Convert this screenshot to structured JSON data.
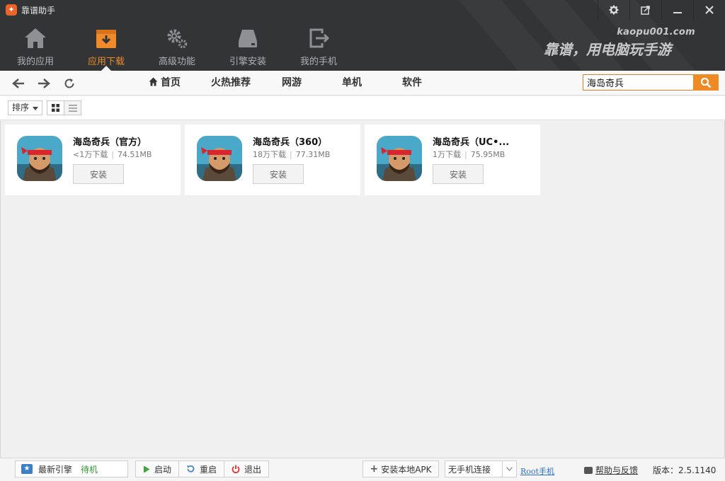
{
  "window": {
    "title": "靠谱助手"
  },
  "nav_tabs": [
    {
      "label": "我的应用",
      "icon": "home-icon",
      "active": false
    },
    {
      "label": "应用下载",
      "icon": "download-box-icon",
      "active": true
    },
    {
      "label": "高级功能",
      "icon": "gears-icon",
      "active": false
    },
    {
      "label": "引擎安装",
      "icon": "drive-icon",
      "active": false
    },
    {
      "label": "我的手机",
      "icon": "phone-exit-icon",
      "active": false
    }
  ],
  "brand": {
    "url": "kaopu001.com",
    "slogan": "靠谱，用电脑玩手游"
  },
  "categories": [
    "首页",
    "火热推荐",
    "网游",
    "单机",
    "软件"
  ],
  "search": {
    "value": "海岛奇兵"
  },
  "sort": {
    "label": "排序"
  },
  "apps": [
    {
      "name": "海岛奇兵（官方）",
      "downloads": "<1万下载",
      "size": "74.51MB",
      "install_label": "安装"
    },
    {
      "name": "海岛奇兵（360）",
      "downloads": "18万下载",
      "size": "77.31MB",
      "install_label": "安装"
    },
    {
      "name": "海岛奇兵（UC•...",
      "downloads": "1万下载",
      "size": "75.95MB",
      "install_label": "安装"
    }
  ],
  "statusbar": {
    "engine_label": "最新引擎",
    "engine_status": "待机",
    "start_label": "启动",
    "restart_label": "重启",
    "exit_label": "退出",
    "install_apk_label": "安装本地APK",
    "phone_status": "无手机连接",
    "root_label": "Root手机",
    "help_label": "帮助与反馈",
    "version": "版本：2.5.1140"
  },
  "colors": {
    "header_bg": "#333436",
    "accent": "#f08a24",
    "active_tab": "#f08a2a",
    "link": "#2a6fd0",
    "engine_status": "#2c9a2c"
  }
}
